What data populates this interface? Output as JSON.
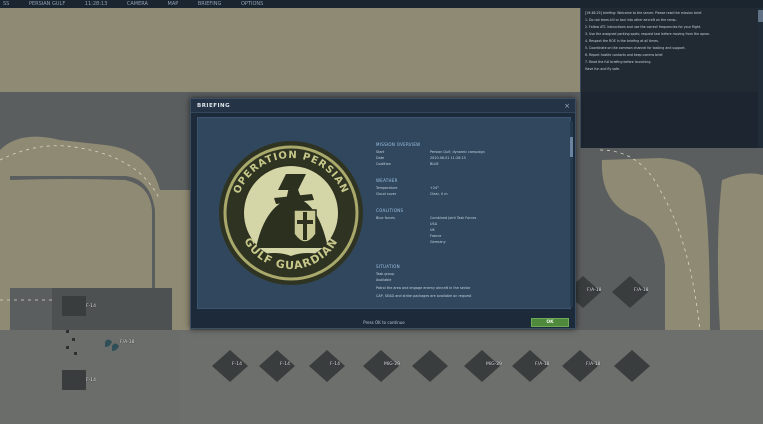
{
  "topbar": {
    "items": [
      "SS",
      "PERSIAN GULF",
      "11:28:13",
      "CAMERA",
      "MAP",
      "BRIEFING",
      "OPTIONS"
    ]
  },
  "chat": {
    "lines": [
      "[19:48:29] briefing: Welcome to the server. Please read the mission brief.",
      "1. Do not team-kill or taxi into other aircraft on the ramp.",
      "2. Follow ATC instructions and use the correct frequencies for your flight.",
      "3. Use the assigned parking spots; request taxi before moving from the apron.",
      "4. Respect the ROE in the briefing at all times.",
      "5. Coordinate on the common channel for tasking and support.",
      "6. Report hostile contacts and keep comms brief.",
      "7. Read the full briefing before launching.",
      "Have fun and fly safe."
    ]
  },
  "modal": {
    "title": "BRIEFING",
    "close_icon": "close-icon",
    "emblem_text_top": "OPERATION PERSIAN",
    "emblem_text_bottom": "GULF GUARDIAN",
    "sections": {
      "mission": {
        "title": "MISSION OVERVIEW",
        "rows": [
          {
            "k": "Start",
            "v": "Persian Gulf, dynamic campaign"
          },
          {
            "k": "Date",
            "v": "2020.06.01 11:28:13"
          },
          {
            "k": "Coalition",
            "v": "BLUE"
          }
        ]
      },
      "weather": {
        "title": "WEATHER",
        "rows": [
          {
            "k": "Temperature",
            "v": "+24°"
          },
          {
            "k": "Cloud cover",
            "v": "Clear, 0 m"
          }
        ]
      },
      "coalitions": {
        "title": "COALITIONS",
        "label": "Blue forces",
        "items": [
          "Combined Joint Task Forces",
          "USA",
          "UK",
          "France",
          "Germany"
        ]
      },
      "tasks": {
        "title": "SITUATION",
        "lines": [
          "Task group",
          "Available",
          "Patrol the area and engage enemy aircraft in the sector",
          "CAP, SEAD and strike packages are available on request"
        ]
      }
    },
    "footer_text": "Press OK to continue",
    "ok_label": "OK"
  },
  "map": {
    "pads": [
      {
        "label": "F-14"
      },
      {
        "label": "F-14"
      },
      {
        "label": "F-14"
      },
      {
        "label": "F-14"
      },
      {
        "label": "F-14"
      },
      {
        "label": "MiG-29"
      },
      {
        "label": "MiG-29"
      },
      {
        "label": "F/A-18"
      },
      {
        "label": "F/A-18"
      },
      {
        "label": "F/A-18"
      },
      {
        "label": "F/A-18"
      },
      {
        "label": "F/A-18"
      }
    ]
  }
}
